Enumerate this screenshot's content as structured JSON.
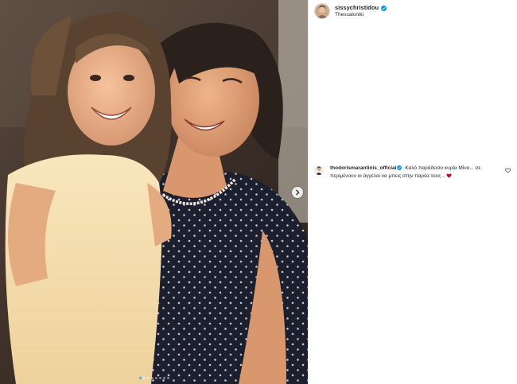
{
  "post": {
    "image_alt": "Vintage photo of a smiling young girl in a yellow dress held by a smiling woman in a dark polka-dot dress",
    "carousel": {
      "slide_count": 8,
      "active_index": 0
    }
  },
  "header": {
    "username": "sissychristidou",
    "location": "Thessaloniki",
    "verified": true
  },
  "comments": [
    {
      "username": "thodorismarantinis_official",
      "verified": true,
      "text": "Καλό παράδεισο κυρία Μίνα... σε περιμένουν οι άγγελοι να μπεις στην παρέα τους ..",
      "trailing_emoji": "red-heart-icon"
    }
  ],
  "icons": {
    "next": "chevron-right-icon",
    "verified": "verified-badge-icon",
    "like": "heart-outline-icon"
  },
  "colors": {
    "verified": "#0095f6",
    "text": "#262626",
    "heart_red": "#d0021b",
    "active_dot": "#4f9eea"
  }
}
